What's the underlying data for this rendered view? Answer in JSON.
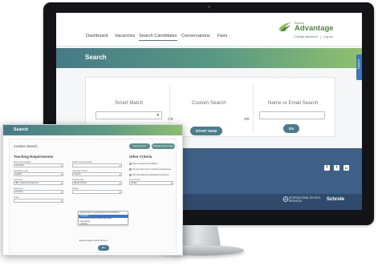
{
  "nav": {
    "items": [
      "Dashboard",
      "Vacancies",
      "Search Candidates",
      "Conversations",
      "Fairs"
    ],
    "active": "Search Candidates"
  },
  "brand": {
    "small": "Schrole",
    "name": "Advantage",
    "change_password": "Change password",
    "separator": "|",
    "logout": "Log out"
  },
  "banner": {
    "title": "Search"
  },
  "support": {
    "label": "Support"
  },
  "search_panel": {
    "smart_match": {
      "title": "Smart Match",
      "button": "Go"
    },
    "or_1": "OR",
    "custom_search": {
      "title": "Custom Search",
      "button": "START NOW"
    },
    "or_2": "OR",
    "name_email": {
      "title": "Name or Email Search",
      "button": "Go"
    }
  },
  "footer": {
    "social": [
      "f",
      "t",
      "in"
    ],
    "isb": "INTERNATIONAL SCHOOL SERVICES",
    "schrole": "Schrole"
  },
  "overlay": {
    "title": "Search",
    "custom_search_label": "Custom Search",
    "reset_button": "Reset search",
    "change_button": "Change level of Save",
    "teaching_requirements": "Teaching Requirements",
    "other_criteria": "Other Criteria",
    "fields": [
      {
        "label": "School Type/Setting",
        "value": "Any/None"
      },
      {
        "label": "Position Type/Specialty",
        "value": ""
      },
      {
        "label": "Language Levels",
        "value": "English"
      },
      {
        "label": "Language Spoken",
        "value": "Teacher"
      },
      {
        "label": "Curriculum",
        "value": "IBD - Diploma Programme"
      },
      {
        "label": "Teaching Age",
        "value": "Middle School"
      },
      {
        "label": "Experience",
        "value": "Full-time"
      },
      {
        "label": "Subject",
        "value": ""
      },
      {
        "label": "Grade",
        "value": ""
      }
    ],
    "criteria": [
      "Has completed international",
      "Current work visa or residency requirement",
      "Has international qualification/experience"
    ],
    "criteria_select_label": "Current Area",
    "criteria_select_value": "Global",
    "dropdown_options": [
      "Teacher/Team Leader/Department Head/Other",
      "Counselor",
      "Technology Support/Digital Specialist",
      "Counselling",
      "Librarian"
    ],
    "dropdown_selected_index": 1,
    "expand_link": "Expand search results above ▾",
    "go_button": "Go"
  }
}
